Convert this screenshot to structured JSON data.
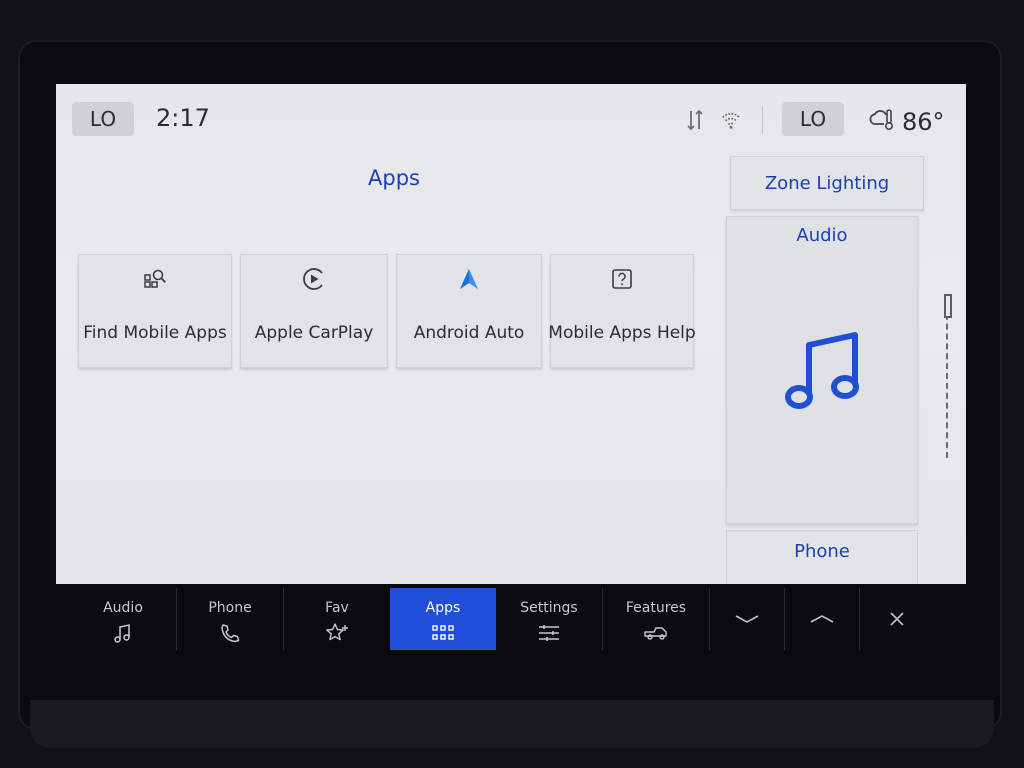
{
  "status_bar": {
    "left_temp_setting": "LO",
    "time": "2:17",
    "icons": [
      "signal-arrows-icon",
      "wifi-icon"
    ],
    "right_temp_setting": "LO",
    "weather_icon": "cloud-thermometer-icon",
    "outside_temp": "86°"
  },
  "page": {
    "title": "Apps"
  },
  "tiles": [
    {
      "label": "Find Mobile Apps",
      "icon": "find-apps-icon"
    },
    {
      "label": "Apple CarPlay",
      "icon": "carplay-icon"
    },
    {
      "label": "Android Auto",
      "icon": "android-auto-icon"
    },
    {
      "label": "Mobile Apps Help",
      "icon": "help-icon"
    }
  ],
  "right_panel": {
    "zone_lighting": "Zone Lighting",
    "audio_label": "Audio",
    "audio_icon": "music-note-icon",
    "phone_label": "Phone"
  },
  "navbar": {
    "items": [
      {
        "label": "Audio",
        "icon": "music-note-icon"
      },
      {
        "label": "Phone",
        "icon": "phone-icon"
      },
      {
        "label": "Fav",
        "icon": "star-plus-icon"
      },
      {
        "label": "Apps",
        "icon": "apps-grid-icon",
        "active": true
      },
      {
        "label": "Settings",
        "icon": "sliders-icon"
      },
      {
        "label": "Features",
        "icon": "truck-icon"
      }
    ],
    "controls": [
      "chevron-down-icon",
      "chevron-up-icon",
      "close-icon"
    ]
  },
  "colors": {
    "accent_blue": "#1c3fae",
    "active_nav": "#1f4fd6",
    "screen_bg": "#e6e7ea",
    "bezel": "#0a0b0d"
  }
}
